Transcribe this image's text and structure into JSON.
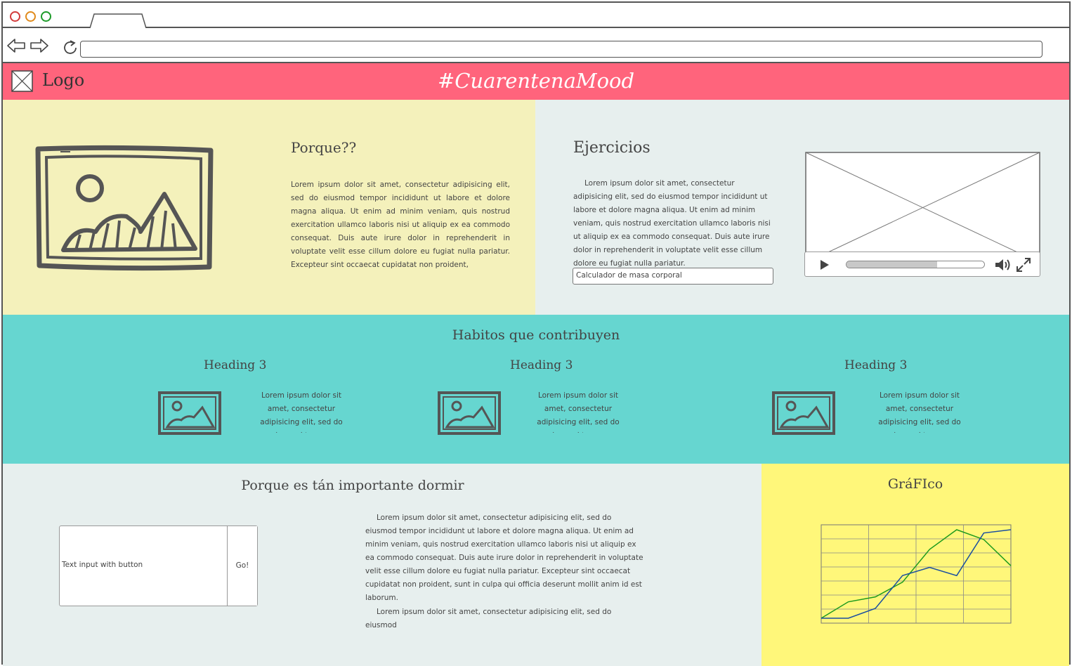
{
  "header": {
    "logo_label": "Logo",
    "site_title": "#CuarentenaMood",
    "color": "#ff647c"
  },
  "porque": {
    "title": "Porque??",
    "body": "Lorem ipsum dolor sit amet, consectetur adipisicing elit, sed do eiusmod tempor incididunt ut labore et dolore magna aliqua. Ut enim ad minim veniam, quis nostrud exercitation ullamco laboris nisi ut aliquip ex ea commodo consequat. Duis aute irure dolor in reprehenderit in voluptate velit esse cillum dolore eu fugiat nulla pariatur. Excepteur sint occaecat cupidatat non proident,",
    "color": "#f4f1bb"
  },
  "ejercicios": {
    "title": "Ejercicios",
    "body": "Lorem ipsum dolor sit amet, consectetur adipisicing elit, sed do eiusmod tempor incididunt ut labore et dolore magna aliqua. Ut enim ad minim veniam, quis nostrud exercitation ullamco laboris nisi ut aliquip ex ea commodo consequat. Duis aute irure dolor in reprehenderit in voluptate velit esse cillum dolore eu fugiat nulla pariatur.",
    "input_value": "Calculador de masa corporal",
    "video_progress": 0.66,
    "color": "#e7efee"
  },
  "habitos": {
    "title": "Habitos que contribuyen",
    "color": "#66d6d0",
    "cards": [
      {
        "heading": "Heading 3",
        "text": "Lorem ipsum dolor sit amet, consectetur adipisicing elit, sed do eiusmod tempor incididunt"
      },
      {
        "heading": "Heading 3",
        "text": "Lorem ipsum dolor sit amet, consectetur adipisicing elit, sed do eiusmod tempor incididunt"
      },
      {
        "heading": "Heading 3",
        "text": "Lorem ipsum dolor sit amet, consectetur adipisicing elit, sed do eiusmod tempor incididunt"
      }
    ]
  },
  "dormir": {
    "title": "Porque es tán importante dormir",
    "input_placeholder": "Text input with button",
    "button_label": "Go!",
    "body1": "Lorem ipsum dolor sit amet, consectetur adipisicing elit, sed do eiusmod tempor incididunt ut labore et dolore magna aliqua. Ut enim ad minim veniam, quis nostrud exercitation ullamco laboris nisi ut aliquip ex ea commodo consequat. Duis aute irure dolor in reprehenderit in voluptate velit esse cillum dolore eu fugiat nulla pariatur. Excepteur sint occaecat cupidatat non proident, sunt in culpa qui officia deserunt mollit anim id est laborum.",
    "body2": "Lorem ipsum dolor sit amet, consectetur adipisicing elit, sed do eiusmod"
  },
  "grafico": {
    "title": "GráFIco",
    "color": "#fff77a"
  },
  "chart_data": {
    "type": "line",
    "title": "",
    "xlabel": "",
    "ylabel": "",
    "grid": true,
    "xlim": [
      0,
      8
    ],
    "ylim": [
      0,
      6
    ],
    "x": [
      0,
      1,
      2,
      3,
      4,
      5,
      6,
      7,
      8
    ],
    "series": [
      {
        "color": "#1e9b1e",
        "values": [
          0.3,
          1.3,
          1.6,
          2.5,
          4.5,
          5.7,
          5.1,
          3.5,
          3.5
        ]
      },
      {
        "color": "#1b4fa0",
        "values": [
          0.3,
          0.3,
          0.9,
          2.9,
          3.4,
          2.9,
          5.5,
          5.7,
          5.7
        ]
      }
    ],
    "x_points": [
      [
        0,
        1,
        2,
        3,
        4,
        5,
        6,
        7
      ],
      [
        0,
        1,
        2,
        3,
        3.5,
        4,
        5,
        6,
        7
      ]
    ],
    "series_points": [
      [
        [
          0.0,
          0.3
        ],
        [
          1.0,
          1.3
        ],
        [
          2.0,
          1.6
        ],
        [
          3.0,
          2.5
        ],
        [
          4.0,
          4.5
        ],
        [
          5.0,
          5.7
        ],
        [
          6.0,
          5.1
        ],
        [
          7.0,
          3.5
        ]
      ],
      [
        [
          0.0,
          0.3
        ],
        [
          1.0,
          0.3
        ],
        [
          2.0,
          0.9
        ],
        [
          3.0,
          2.9
        ],
        [
          4.0,
          3.4
        ],
        [
          5.0,
          2.9
        ],
        [
          6.0,
          5.5
        ],
        [
          7.0,
          5.7
        ]
      ]
    ]
  }
}
